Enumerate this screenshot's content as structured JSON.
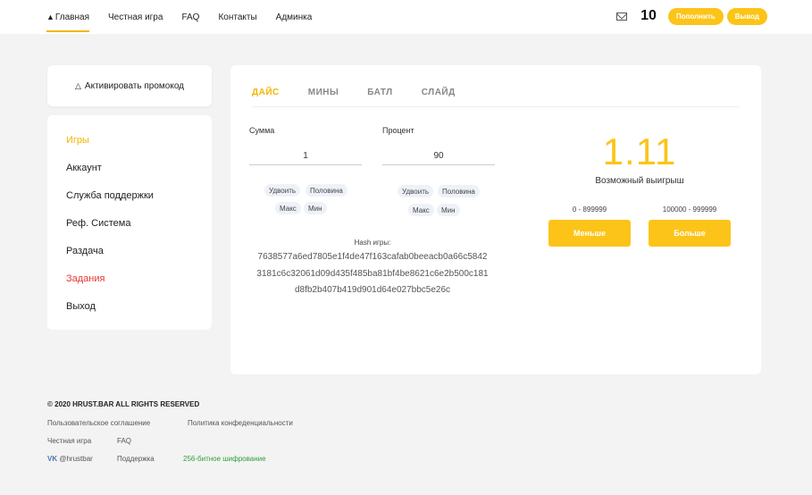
{
  "nav": {
    "items": [
      "Главная",
      "Честная игра",
      "FAQ",
      "Контакты",
      "Админка"
    ],
    "balance": "10",
    "deposit_label": "Пополнить",
    "withdraw_label": "Вывод"
  },
  "promo": {
    "label": "Активировать промокод"
  },
  "sidebar": {
    "items": [
      "Игры",
      "Аккаунт",
      "Служба поддержки",
      "Реф. Система",
      "Раздача",
      "Задания",
      "Выход"
    ]
  },
  "game": {
    "tabs": [
      "ДАЙС",
      "МИНЫ",
      "БАТЛ",
      "СЛАЙД"
    ],
    "amount_label": "Сумма",
    "amount_value": "1",
    "percent_label": "Процент",
    "percent_value": "90",
    "chips": {
      "double": "Удвоить",
      "half": "Половина",
      "max": "Макс",
      "min": "Мин"
    },
    "hash_label": "Hash игры:",
    "hash_lines": [
      "7638577a6ed7805e1f4de47f163cafab0beeacb0a66c5842",
      "3181c6c32061d09d435f485ba81bf4be8621c6e2b500c181",
      "d8fb2b407b419d901d64e027bbc5e26c"
    ],
    "multiplier": "1.11",
    "win_label": "Возможный выигрыш",
    "low_range": "0 - 899999",
    "high_range": "100000 - 999999",
    "less_label": "Меньше",
    "more_label": "Больше"
  },
  "footer": {
    "copyright": "© 2020 HRUST.BAR ALL RIGHTS RESERVED",
    "agreement": "Пользовательское соглашение",
    "privacy": "Политика конфеденциальности",
    "fair": "Честная игра",
    "faq": "FAQ",
    "vk": "VK",
    "vk_handle": "@hrustbar",
    "support": "Поддержка",
    "encryption": "256-битное шифрование"
  },
  "colors": {
    "accent": "#fcc419",
    "danger": "#e53935",
    "link": "#4a76a8",
    "success": "#2e9d3b"
  }
}
